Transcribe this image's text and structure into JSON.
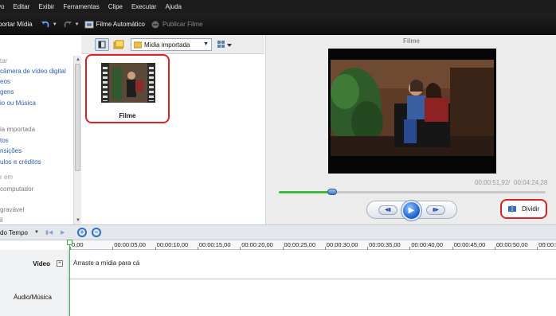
{
  "menu": [
    "vo",
    "Editar",
    "Exibir",
    "Ferramentas",
    "Clipe",
    "Executar",
    "Ajuda"
  ],
  "toolbar": {
    "import_label": "portar Mídia",
    "auto_movie_label": "Filme Automático",
    "publish_label": "Publicar Filme"
  },
  "tasks": {
    "header_capture": "tar",
    "capture_camera": "câmera de vídeo digital",
    "capture_videos": "eos",
    "capture_images": "gens",
    "capture_audio": "io ou Música",
    "header_edit": "ia importada",
    "edit_effects": "tos",
    "edit_transitions": "nsições",
    "edit_titles": "ulos e créditos",
    "header_publish": "r em",
    "publish_computer": "computador",
    "publish_writable": "gravável",
    "publish_email": "il"
  },
  "collection": {
    "dropdown_value": "Mídia importada",
    "clip_label": "Filme"
  },
  "preview": {
    "title": "Filme",
    "current_time": "00:00:51,92",
    "separator": " / ",
    "total_time": "00:04:24,28",
    "progress": 0.2,
    "split_label": "Dividir"
  },
  "timeline": {
    "mode_label": "do Tempo",
    "ruler": [
      "0,00",
      "00:00:05,00",
      "00:00:10,00",
      "00:00:15,00",
      "00:00:20,00",
      "00:00:25,00",
      "00:00:30,00",
      "00:00:35,00",
      "00:00:40,00",
      "00:00:45,00",
      "00:00:50,00",
      "00:00:5"
    ],
    "video_track_label": "Vídeo",
    "audio_track_label": "Áudio/Música",
    "drop_hint": "Arraste a mídia para cá"
  },
  "colors": {
    "highlight_red": "#e02020",
    "progress_green": "#3dba3d",
    "link_blue": "#2a5db0",
    "menu_bg": "#1c1c1c"
  }
}
